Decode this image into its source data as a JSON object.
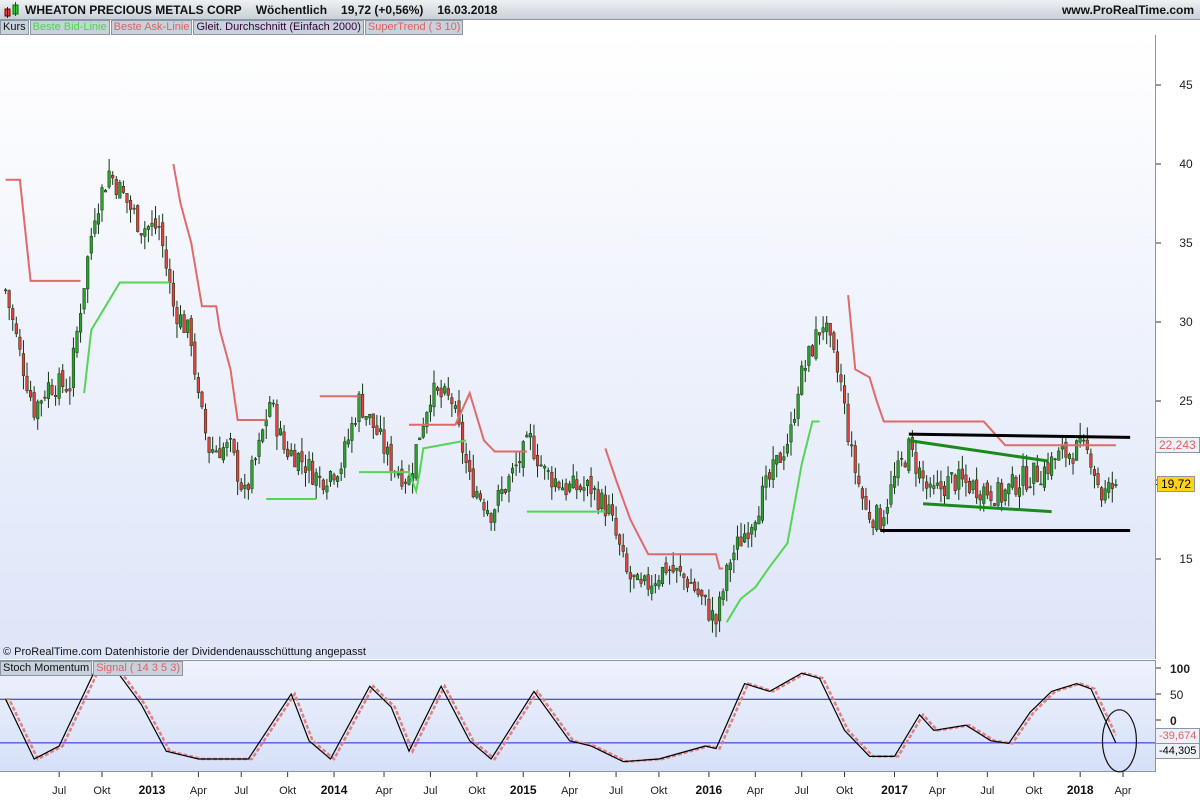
{
  "header": {
    "instrument": "WHEATON PRECIOUS METALS CORP",
    "period": "Wöchentlich",
    "price": "19,72 (+0,56%)",
    "date": "16.03.2018",
    "site": "www.ProRealTime.com"
  },
  "legend": {
    "kurs": "Kurs",
    "bid": "Beste Bid-Linie",
    "ask": "Beste Ask-Linie",
    "sma": "Gleit. Durchschnitt (Einfach 2000)",
    "supertrend": "SuperTrend ( 3 10)"
  },
  "note": "© ProRealTime.com  Datenhistorie der Dividendenausschüttung angepasst",
  "stoch_legend": {
    "name": "Stoch Momentum",
    "signal": "Signal ( 14 3 5 3)"
  },
  "badges": {
    "supertrend_value": "22,243",
    "last_price": "19,72",
    "signal_value": "-39,674",
    "stoch_value": "-44,305"
  },
  "colors": {
    "bull": "#2e9e2e",
    "bear": "#e04040",
    "ask": "#e06a6a",
    "bid": "#55d455",
    "stoch": "#000000",
    "signal": "#e08080",
    "hline": "#2020d0"
  },
  "chart_data": [
    {
      "type": "candlestick",
      "title": "WHEATON PRECIOUS METALS CORP Wöchentlich",
      "ylim": [
        10,
        48
      ],
      "yticks": [
        15,
        20,
        25,
        30,
        35,
        40,
        45
      ],
      "ytick_labels": [
        "15",
        "",
        "25",
        "30",
        "35",
        "40",
        "45"
      ],
      "x_unit": "week index (0 = mid Apr 2012)",
      "xticks": [
        {
          "w": 15,
          "label": "Jul"
        },
        {
          "w": 27,
          "label": "Okt"
        },
        {
          "w": 41,
          "label": "2013",
          "year": true
        },
        {
          "w": 54,
          "label": "Apr"
        },
        {
          "w": 66,
          "label": "Jul"
        },
        {
          "w": 79,
          "label": "Okt"
        },
        {
          "w": 92,
          "label": "2014",
          "year": true
        },
        {
          "w": 106,
          "label": "Apr"
        },
        {
          "w": 119,
          "label": "Jul"
        },
        {
          "w": 132,
          "label": "Okt"
        },
        {
          "w": 145,
          "label": "2015",
          "year": true
        },
        {
          "w": 158,
          "label": "Apr"
        },
        {
          "w": 171,
          "label": "Jul"
        },
        {
          "w": 183,
          "label": "Okt"
        },
        {
          "w": 197,
          "label": "2016",
          "year": true
        },
        {
          "w": 210,
          "label": "Apr"
        },
        {
          "w": 223,
          "label": "Jul"
        },
        {
          "w": 235,
          "label": "Okt"
        },
        {
          "w": 249,
          "label": "2017",
          "year": true
        },
        {
          "w": 261,
          "label": "Apr"
        },
        {
          "w": 275,
          "label": "Jul"
        },
        {
          "w": 288,
          "label": "Okt"
        },
        {
          "w": 301,
          "label": "2018",
          "year": true
        },
        {
          "w": 313,
          "label": "Apr"
        }
      ],
      "close_anchors": [
        [
          0,
          32
        ],
        [
          4,
          28
        ],
        [
          8,
          24.5
        ],
        [
          12,
          26
        ],
        [
          18,
          26
        ],
        [
          21,
          31
        ],
        [
          25,
          37
        ],
        [
          29,
          39.5
        ],
        [
          33,
          38
        ],
        [
          38,
          36
        ],
        [
          43,
          36
        ],
        [
          47,
          31
        ],
        [
          52,
          29
        ],
        [
          54,
          25
        ],
        [
          57,
          22
        ],
        [
          63,
          22
        ],
        [
          67,
          19
        ],
        [
          71,
          22
        ],
        [
          74,
          25
        ],
        [
          78,
          22
        ],
        [
          82,
          21.5
        ],
        [
          88,
          20
        ],
        [
          94,
          21
        ],
        [
          99,
          25
        ],
        [
          104,
          23
        ],
        [
          108,
          21
        ],
        [
          113,
          20
        ],
        [
          116,
          23
        ],
        [
          119,
          25.5
        ],
        [
          125,
          25
        ],
        [
          130,
          20
        ],
        [
          136,
          18
        ],
        [
          141,
          20
        ],
        [
          147,
          22.5
        ],
        [
          151,
          20.5
        ],
        [
          157,
          19.5
        ],
        [
          164,
          19.5
        ],
        [
          169,
          18
        ],
        [
          174,
          14
        ],
        [
          178,
          13
        ],
        [
          185,
          14.5
        ],
        [
          192,
          13.5
        ],
        [
          199,
          11
        ],
        [
          203,
          15
        ],
        [
          209,
          17.5
        ],
        [
          214,
          20
        ],
        [
          220,
          23
        ],
        [
          222,
          26
        ],
        [
          227,
          29
        ],
        [
          229,
          30
        ],
        [
          234,
          26
        ],
        [
          237,
          21.5
        ],
        [
          241,
          18
        ],
        [
          245,
          17.5
        ],
        [
          249,
          20
        ],
        [
          253,
          22
        ],
        [
          259,
          19
        ],
        [
          265,
          20
        ],
        [
          273,
          19.5
        ],
        [
          279,
          19
        ],
        [
          284,
          20
        ],
        [
          290,
          20.5
        ],
        [
          295,
          21.5
        ],
        [
          301,
          22
        ],
        [
          304,
          21.5
        ],
        [
          307,
          19
        ],
        [
          311,
          19.72
        ]
      ],
      "supertrend": [
        {
          "side": "ask",
          "points": [
            [
              0,
              39
            ],
            [
              4,
              39
            ],
            [
              7,
              32.6
            ],
            [
              21,
              32.6
            ]
          ]
        },
        {
          "side": "bid",
          "points": [
            [
              22,
              25.5
            ],
            [
              24,
              29.5
            ],
            [
              32,
              32.5
            ],
            [
              46,
              32.5
            ]
          ]
        },
        {
          "side": "ask",
          "points": [
            [
              47,
              40
            ],
            [
              49,
              37.5
            ],
            [
              52,
              35
            ],
            [
              55,
              31
            ],
            [
              59,
              31
            ],
            [
              60,
              29.5
            ],
            [
              63,
              27
            ],
            [
              65,
              23.8
            ],
            [
              73,
              23.8
            ]
          ]
        },
        {
          "side": "bid",
          "points": [
            [
              73,
              18.8
            ],
            [
              74,
              18.8
            ],
            [
              87,
              18.8
            ]
          ]
        },
        {
          "side": "ask",
          "points": [
            [
              88,
              25.3
            ],
            [
              99,
              25.3
            ]
          ]
        },
        {
          "side": "bid",
          "points": [
            [
              99,
              20.5
            ],
            [
              113,
              20.5
            ],
            [
              115,
              19.3
            ],
            [
              116,
              20.5
            ],
            [
              117,
              22
            ],
            [
              129,
              22.5
            ]
          ]
        },
        {
          "side": "ask",
          "points": [
            [
              113,
              23.5
            ],
            [
              126,
              23.5
            ],
            [
              130,
              25.5
            ],
            [
              134,
              22.5
            ],
            [
              137,
              21.8
            ],
            [
              146,
              21.8
            ]
          ]
        },
        {
          "side": "bid",
          "points": [
            [
              146,
              18
            ],
            [
              168,
              18
            ]
          ]
        },
        {
          "side": "ask",
          "points": [
            [
              168,
              22
            ],
            [
              171,
              20
            ],
            [
              175,
              17.5
            ],
            [
              180,
              15.3
            ],
            [
              199,
              15.3
            ],
            [
              200,
              14.4
            ],
            [
              201,
              14.4
            ]
          ]
        },
        {
          "side": "bid",
          "points": [
            [
              202,
              11
            ],
            [
              206,
              12.5
            ],
            [
              210,
              13.2
            ],
            [
              214,
              14.5
            ],
            [
              219,
              16
            ],
            [
              223,
              21
            ],
            [
              226,
              23.7
            ],
            [
              228,
              23.7
            ]
          ]
        },
        {
          "side": "ask",
          "points": [
            [
              236,
              31.7
            ],
            [
              238,
              27
            ],
            [
              242,
              26.5
            ],
            [
              244,
              25
            ],
            [
              246,
              23.7
            ],
            [
              274,
              23.7
            ],
            [
              280,
              22.2
            ],
            [
              311,
              22.2
            ]
          ]
        }
      ],
      "annotations": [
        {
          "type": "trendline",
          "color": "#000000",
          "from": [
            253,
            22.9
          ],
          "to": [
            315,
            22.7
          ]
        },
        {
          "type": "trendline",
          "color": "#000000",
          "from": [
            245,
            16.8
          ],
          "to": [
            315,
            16.8
          ]
        },
        {
          "type": "trendline",
          "color": "#1a8a1a",
          "from": [
            253,
            22.5
          ],
          "to": [
            292,
            21.2
          ]
        },
        {
          "type": "trendline",
          "color": "#1a8a1a",
          "from": [
            257,
            18.5
          ],
          "to": [
            293,
            18.0
          ]
        }
      ]
    },
    {
      "type": "line",
      "title": "Stoch Momentum",
      "ylim": [
        -100,
        100
      ],
      "yticks": [
        100,
        50,
        0
      ],
      "hlines": [
        40,
        -44
      ],
      "stoch_anchors": [
        [
          0,
          40
        ],
        [
          8,
          -75
        ],
        [
          15,
          -50
        ],
        [
          25,
          95
        ],
        [
          31,
          95
        ],
        [
          38,
          30
        ],
        [
          45,
          -60
        ],
        [
          54,
          -75
        ],
        [
          68,
          -75
        ],
        [
          80,
          50
        ],
        [
          85,
          -40
        ],
        [
          91,
          -75
        ],
        [
          102,
          65
        ],
        [
          108,
          25
        ],
        [
          113,
          -60
        ],
        [
          122,
          65
        ],
        [
          130,
          -40
        ],
        [
          136,
          -75
        ],
        [
          148,
          55
        ],
        [
          158,
          -40
        ],
        [
          164,
          -50
        ],
        [
          173,
          -80
        ],
        [
          183,
          -75
        ],
        [
          196,
          -50
        ],
        [
          199,
          -55
        ],
        [
          207,
          70
        ],
        [
          214,
          55
        ],
        [
          223,
          90
        ],
        [
          228,
          80
        ],
        [
          235,
          -20
        ],
        [
          242,
          -70
        ],
        [
          249,
          -70
        ],
        [
          256,
          10
        ],
        [
          260,
          -20
        ],
        [
          269,
          -10
        ],
        [
          276,
          -40
        ],
        [
          281,
          -45
        ],
        [
          287,
          15
        ],
        [
          293,
          55
        ],
        [
          300,
          70
        ],
        [
          304,
          60
        ],
        [
          311,
          -44.3
        ]
      ],
      "ellipse": {
        "center": [
          312,
          -40
        ],
        "note": "circled"
      }
    }
  ]
}
